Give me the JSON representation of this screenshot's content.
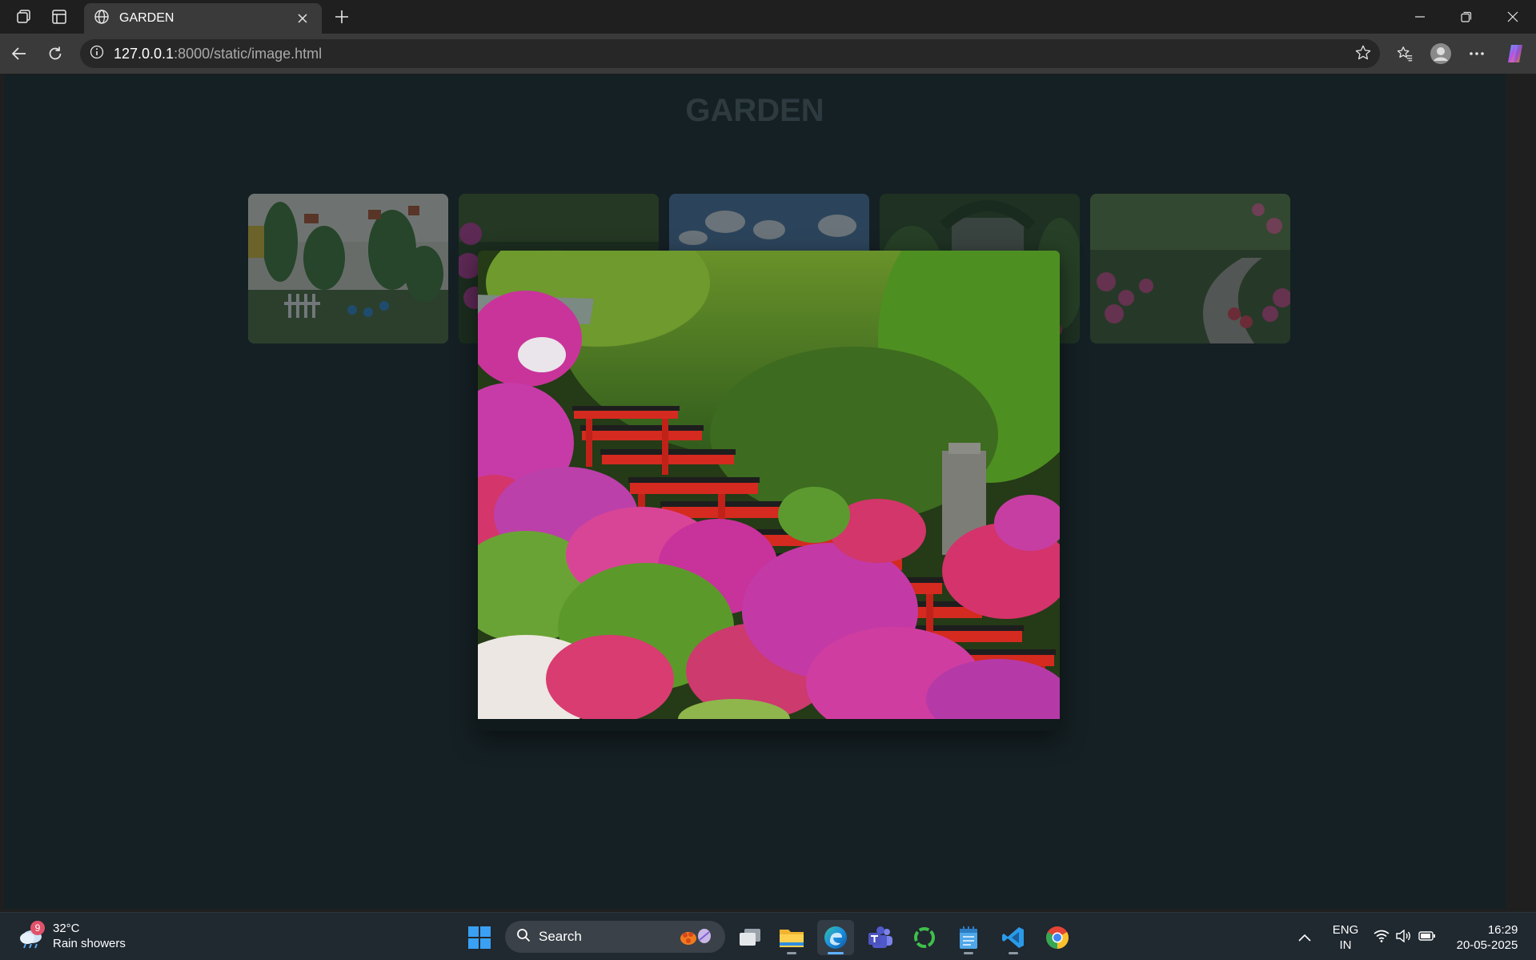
{
  "browser": {
    "tab": {
      "title": "GARDEN"
    },
    "address": {
      "host": "127.0.0.1",
      "rest": ":8000/static/image.html"
    }
  },
  "page": {
    "heading": "GARDEN",
    "thumbnails": [
      {
        "subject": "potted plants balcony"
      },
      {
        "subject": "flower garden"
      },
      {
        "subject": "sky garden"
      },
      {
        "subject": "garden arch"
      },
      {
        "subject": "flower path garden"
      }
    ],
    "modal_image": {
      "subject": "azalea shrine with red torii gates"
    }
  },
  "taskbar": {
    "weather": {
      "temp": "32°C",
      "condition": "Rain showers",
      "badge": "9"
    },
    "search": {
      "label": "Search"
    },
    "language": {
      "line1": "ENG",
      "line2": "IN"
    },
    "clock": {
      "time": "16:29",
      "date": "20-05-2025"
    }
  },
  "colors": {
    "page_bg": "#152024",
    "torii": "#d42a1f",
    "azalea_pink": "#d9359b"
  }
}
